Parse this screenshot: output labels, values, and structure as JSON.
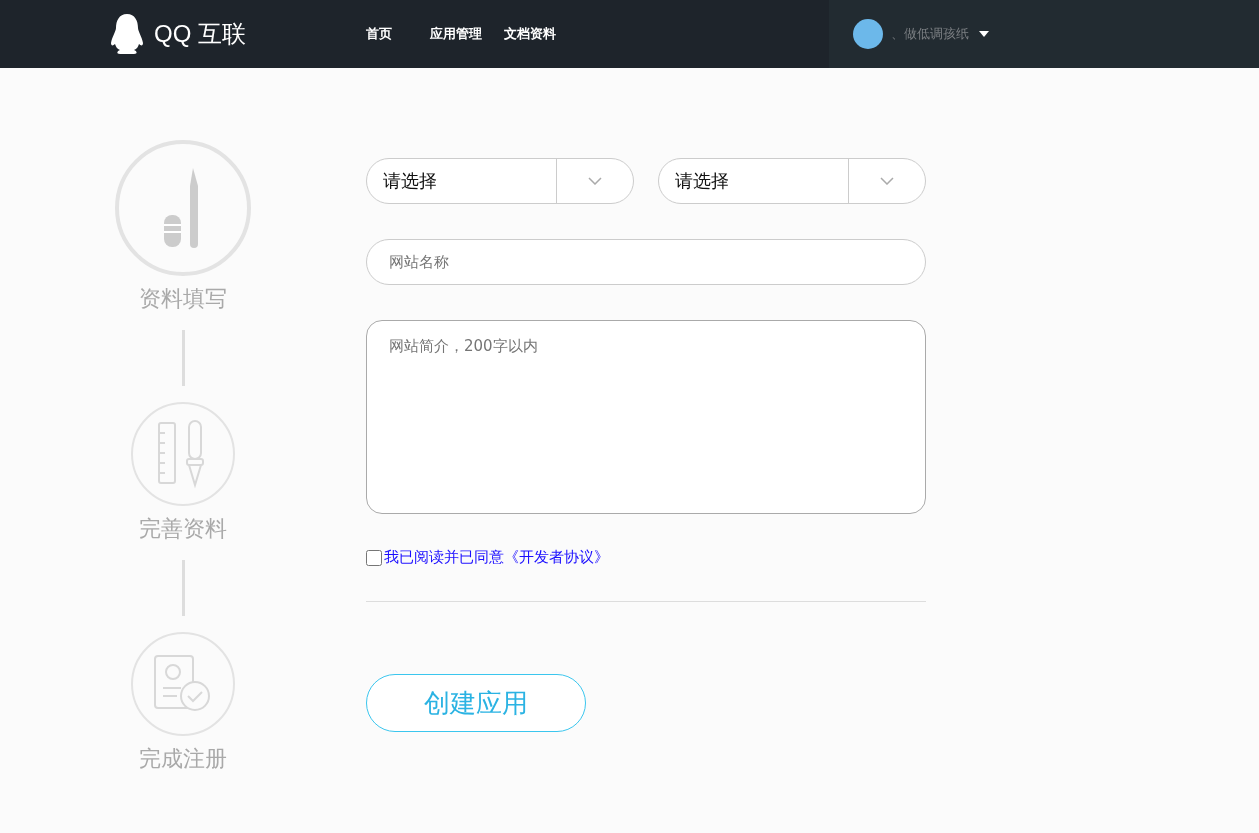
{
  "header": {
    "logo_text": "QQ 互联",
    "nav": [
      {
        "label": "首页",
        "selected": false
      },
      {
        "label": "应用管理",
        "selected": false
      },
      {
        "label": "文档资料",
        "selected": false
      }
    ],
    "user": {
      "name": "、做低调孩纸"
    }
  },
  "steps": [
    {
      "kind": "edit",
      "label": "资料填写",
      "selected": true
    },
    {
      "kind": "tools",
      "label": "完善资料",
      "selected": false
    },
    {
      "kind": "done",
      "label": "完成注册",
      "selected": false
    }
  ],
  "form": {
    "selects": [
      {
        "value": "请选择"
      },
      {
        "value": "请选择"
      }
    ],
    "site_name": {
      "placeholder": "网站名称"
    },
    "site_intro": {
      "placeholder": "网站简介，200字以内"
    },
    "agreement": {
      "text": "我已阅读并已同意《开发者协议》",
      "checked": false
    },
    "submit": "创建应用"
  }
}
